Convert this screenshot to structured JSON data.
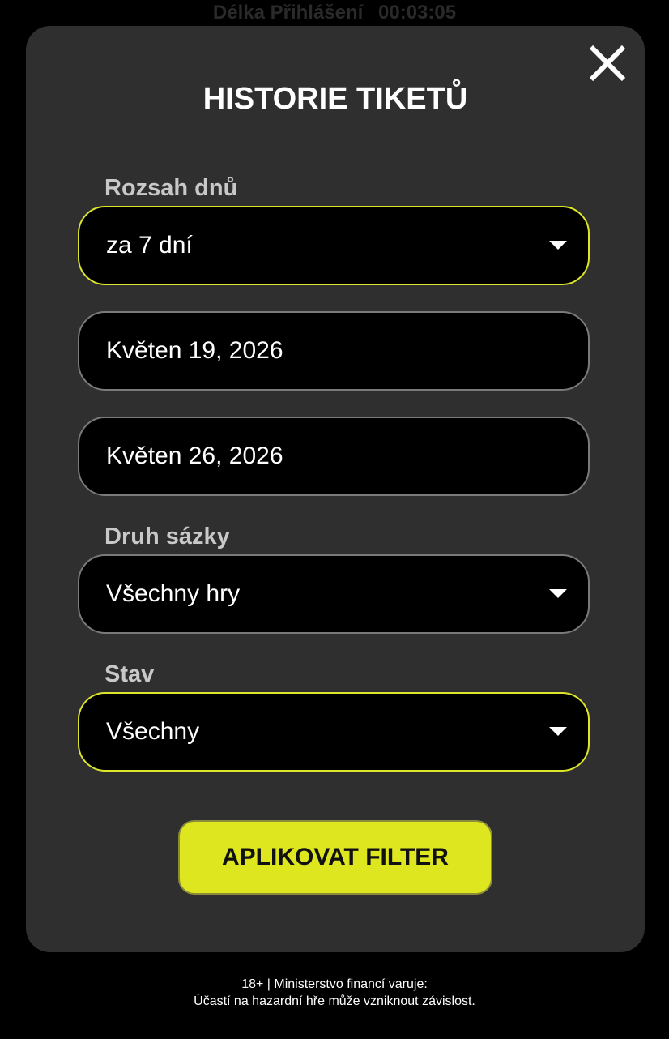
{
  "session": {
    "label": "Délka Přihlášení",
    "time": "00:03:05"
  },
  "modal": {
    "title": "HISTORIE TIKETŮ",
    "close_icon": "close-icon",
    "date_range": {
      "label": "Rozsah dnů",
      "value": "za 7 dní"
    },
    "date_from": {
      "value": "Květen 19, 2026"
    },
    "date_to": {
      "value": "Květen 26, 2026"
    },
    "bet_type": {
      "label": "Druh sázky",
      "value": "Všechny hry"
    },
    "status": {
      "label": "Stav",
      "value": "Všechny"
    },
    "apply_label": "APLIKOVAT FILTER"
  },
  "footer": {
    "line1": "18+ | Ministerstvo financí varuje:",
    "line2": "Účastí na hazardní hře může vzniknout závislost."
  },
  "colors": {
    "accent": "#dde61e",
    "modal_bg": "#2f2f2f",
    "field_bg": "#000000",
    "field_border": "#7a7a7a"
  }
}
